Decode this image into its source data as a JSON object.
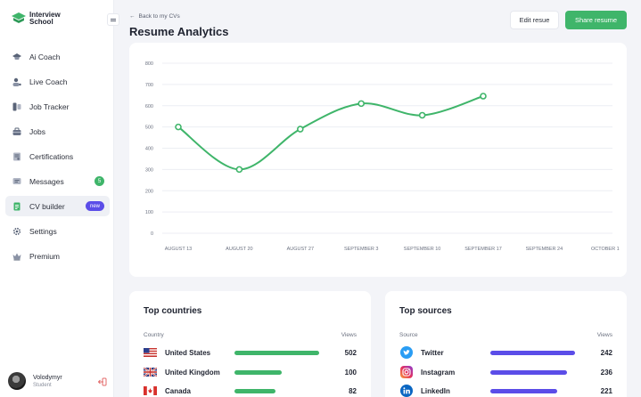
{
  "brand": {
    "line1": "Interview",
    "line2": "School"
  },
  "sidebar": {
    "items": [
      {
        "label": "Ai Coach",
        "icon": "graduation-cap-icon"
      },
      {
        "label": "Live Coach",
        "icon": "user-icon"
      },
      {
        "label": "Job Tracker",
        "icon": "tracker-icon"
      },
      {
        "label": "Jobs",
        "icon": "briefcase-icon"
      },
      {
        "label": "Certifications",
        "icon": "certificate-icon"
      },
      {
        "label": "Messages",
        "icon": "message-icon",
        "badge": "5"
      },
      {
        "label": "CV builder",
        "icon": "document-icon",
        "badge": "new",
        "active": true
      },
      {
        "label": "Settings",
        "icon": "gear-icon"
      },
      {
        "label": "Premium",
        "icon": "crown-icon"
      }
    ]
  },
  "user": {
    "name": "Volodymyr",
    "role": "Student"
  },
  "header": {
    "back": "Back to my CVs",
    "title": "Resume Analytics",
    "edit_label": "Edit resue",
    "share_label": "Share resume"
  },
  "colors": {
    "accent": "#3fb56a",
    "indigo": "#5b4de8"
  },
  "chart_data": {
    "type": "line",
    "categories": [
      "AUGUST 13",
      "AUGUST 20",
      "AUGUST 27",
      "SEPTEMBER 3",
      "SEPTEMBER 10",
      "SEPTEMBER 17",
      "SEPTEMBER 24",
      "OCTOBER 1"
    ],
    "yticks": [
      0,
      100,
      200,
      300,
      400,
      500,
      600,
      700,
      800
    ],
    "ylim": [
      0,
      800
    ],
    "series": [
      {
        "color": "#3fb56a",
        "values": [
          500,
          300,
          490,
          610,
          555,
          645
        ]
      }
    ],
    "grid": true
  },
  "countries": {
    "title": "Top countries",
    "col_left": "Country",
    "col_right": "Views",
    "max": 502,
    "rows": [
      {
        "label": "United States",
        "value": 502,
        "flag": "us-flag-icon"
      },
      {
        "label": "United Kingdom",
        "value": 100,
        "flag": "uk-flag-icon",
        "fill": 0.55
      },
      {
        "label": "Canada",
        "value": 82,
        "flag": "canada-flag-icon",
        "fill": 0.48
      }
    ]
  },
  "sources": {
    "title": "Top sources",
    "col_left": "Source",
    "col_right": "Views",
    "rows": [
      {
        "label": "Twitter",
        "value": 242,
        "icon": "twitter-icon",
        "fill": 1.0
      },
      {
        "label": "Instagram",
        "value": 236,
        "icon": "instagram-icon",
        "fill": 0.93
      },
      {
        "label": "LinkedIn",
        "value": 221,
        "icon": "linkedin-icon",
        "fill": 0.87
      }
    ]
  }
}
